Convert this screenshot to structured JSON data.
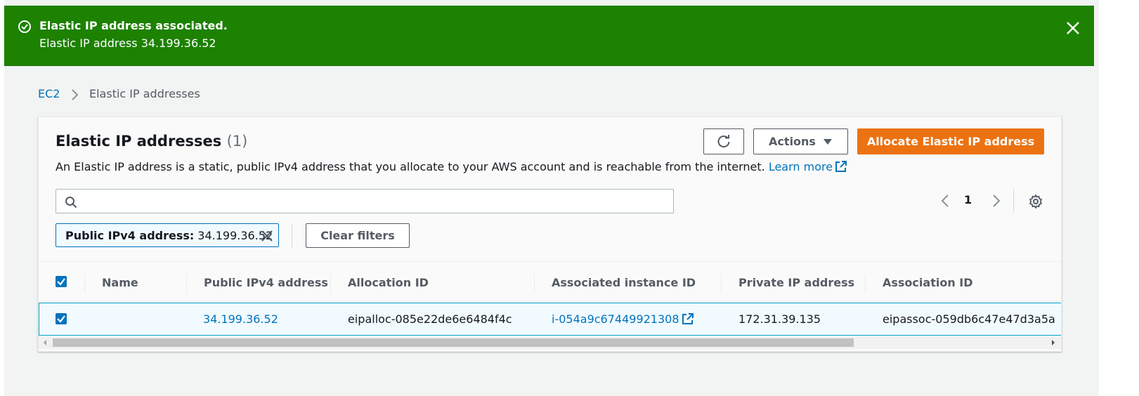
{
  "flash": {
    "title": "Elastic IP address associated.",
    "message": "Elastic IP address 34.199.36.52",
    "type": "success",
    "color": "#1d8102"
  },
  "breadcrumb": {
    "items": [
      "EC2",
      "Elastic IP addresses"
    ]
  },
  "header": {
    "title": "Elastic IP addresses",
    "count": "(1)",
    "description": "An Elastic IP address is a static, public IPv4 address that you allocate to your AWS account and is reachable from the internet.",
    "learn_more": "Learn more"
  },
  "toolbar": {
    "refresh_icon": "refresh-icon",
    "actions_label": "Actions",
    "allocate_label": "Allocate Elastic IP address",
    "primary_color": "#ec7211"
  },
  "search": {
    "placeholder": "",
    "value": ""
  },
  "pagination": {
    "current_page": "1"
  },
  "filter": {
    "token_key": "Public IPv4 address:",
    "token_value": "34.199.36.52",
    "clear_label": "Clear filters"
  },
  "table": {
    "columns": [
      "Name",
      "Public IPv4 address",
      "Allocation ID",
      "Associated instance ID",
      "Private IP address",
      "Association ID"
    ],
    "rows": [
      {
        "selected": true,
        "name": "",
        "public_ip": "34.199.36.52",
        "allocation_id": "eipalloc-085e22de6e6484f4c",
        "instance_id": "i-054a9c67449921308",
        "private_ip": "172.31.39.135",
        "association_id": "eipassoc-059db6c47e47d3a5a"
      }
    ]
  },
  "colors": {
    "link": "#0073bb",
    "selected_row": "#f1faff"
  }
}
